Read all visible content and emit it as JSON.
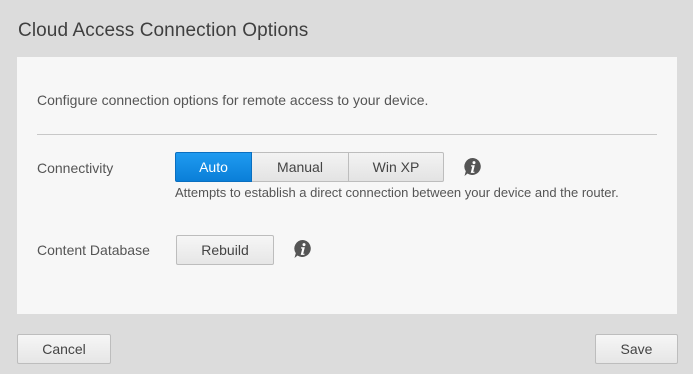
{
  "dialog": {
    "title": "Cloud Access Connection Options",
    "description": "Configure connection options for remote access to your device."
  },
  "connectivity": {
    "label": "Connectivity",
    "options": [
      "Auto",
      "Manual",
      "Win XP"
    ],
    "selected": "Auto",
    "hint": "Attempts to establish a direct connection between your device and the router."
  },
  "content_database": {
    "label": "Content Database",
    "rebuild_label": "Rebuild"
  },
  "footer": {
    "cancel_label": "Cancel",
    "save_label": "Save"
  },
  "colors": {
    "accent": "#0a86e0",
    "info_icon": "#555555"
  },
  "icons": {
    "connectivity_info": "info-bubble-icon",
    "database_info": "info-bubble-icon"
  }
}
